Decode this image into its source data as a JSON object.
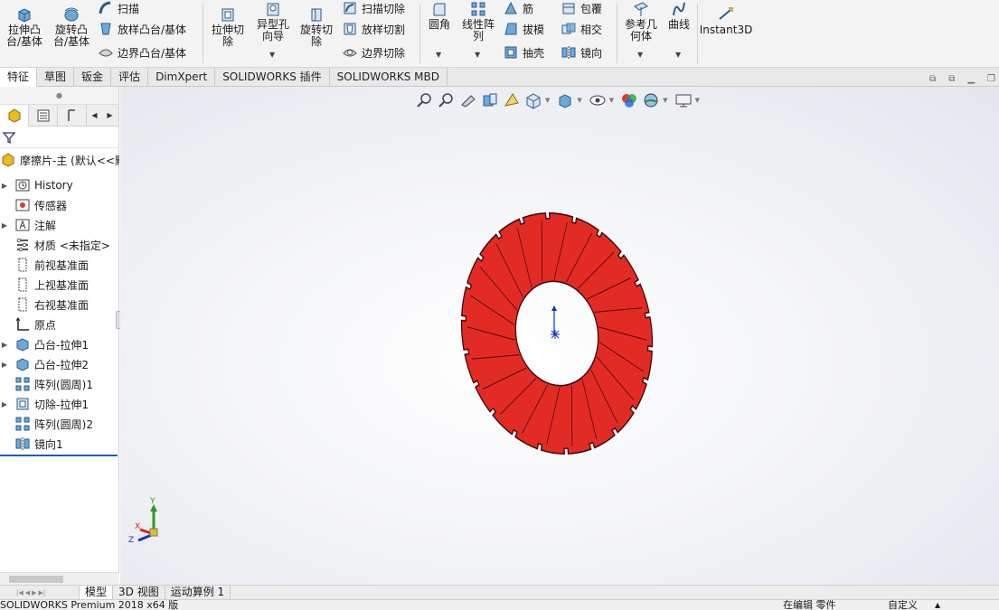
{
  "ribbon": {
    "extrude_boss": "拉伸凸\n台/基体",
    "revolve_boss": "旋转凸\n台/基体",
    "sweep": "扫描",
    "loft_boss": "放样凸台/基体",
    "boundary_boss": "边界凸台/基体",
    "extrude_cut": "拉伸切\n除",
    "hole_wizard": "异型孔\n向导",
    "revolve_cut": "旋转切\n除",
    "sweep_cut": "扫描切除",
    "loft_cut": "放样切割",
    "boundary_cut": "边界切除",
    "fillet": "圆角",
    "linear_pattern": "线性阵\n列",
    "rib": "筋",
    "draft": "拔模",
    "shell": "抽壳",
    "wrap": "包覆",
    "intersect": "相交",
    "mirror": "镜向",
    "ref_geometry": "参考几\n何体",
    "curves": "曲线",
    "instant3d": "Instant3D"
  },
  "tabs": [
    "特征",
    "草图",
    "钣金",
    "评估",
    "DimXpert",
    "SOLIDWORKS 插件",
    "SOLIDWORKS MBD"
  ],
  "tree": {
    "root": "摩擦片-主 (默认<<默",
    "items": [
      "History",
      "传感器",
      "注解",
      "材质 <未指定>",
      "前视基准面",
      "上视基准面",
      "右视基准面",
      "原点",
      "凸台-拉伸1",
      "凸台-拉伸2",
      "阵列(圆周)1",
      "切除-拉伸1",
      "阵列(圆周)2",
      "镜向1"
    ]
  },
  "triad": {
    "x": "X",
    "y": "Y",
    "z": "Z"
  },
  "bottom_tabs": [
    "模型",
    "3D 视图",
    "运动算例 1"
  ],
  "status": {
    "app": "SOLIDWORKS Premium 2018 x64 版",
    "editing": "在编辑 零件",
    "units": "自定义"
  },
  "colors": {
    "part": "#e32b26",
    "accent": "#0a5fb4"
  }
}
